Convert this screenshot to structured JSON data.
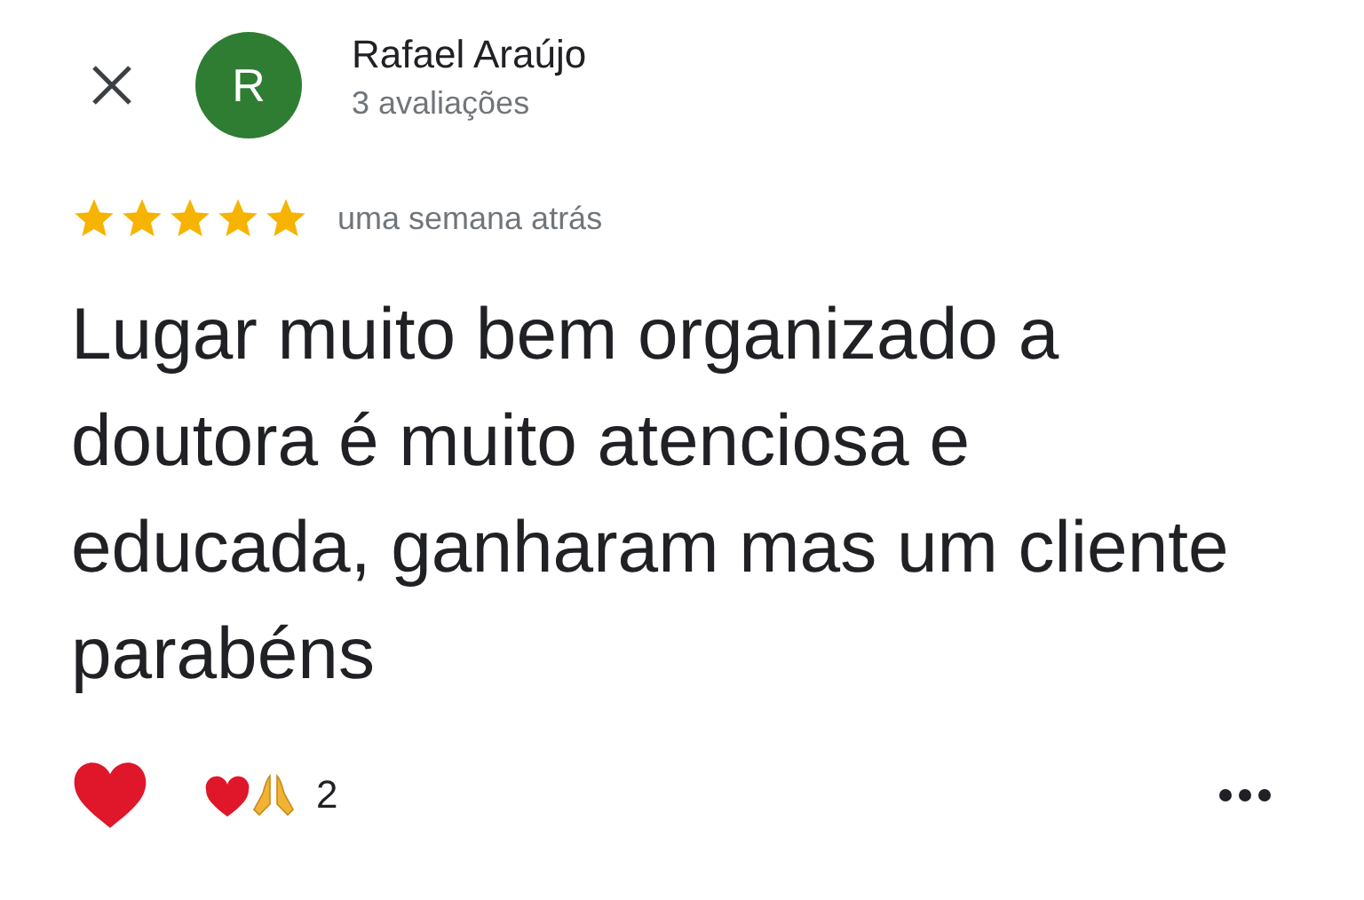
{
  "reviewer": {
    "name": "Rafael Araújo",
    "initial": "R",
    "review_count": "3 avaliações"
  },
  "rating": {
    "stars": 5,
    "time": "uma semana atrás"
  },
  "review_text": "Lugar muito bem organizado a doutora é muito atenciosa e educada, ganharam mas um cliente parabéns",
  "reactions": {
    "count": "2"
  }
}
